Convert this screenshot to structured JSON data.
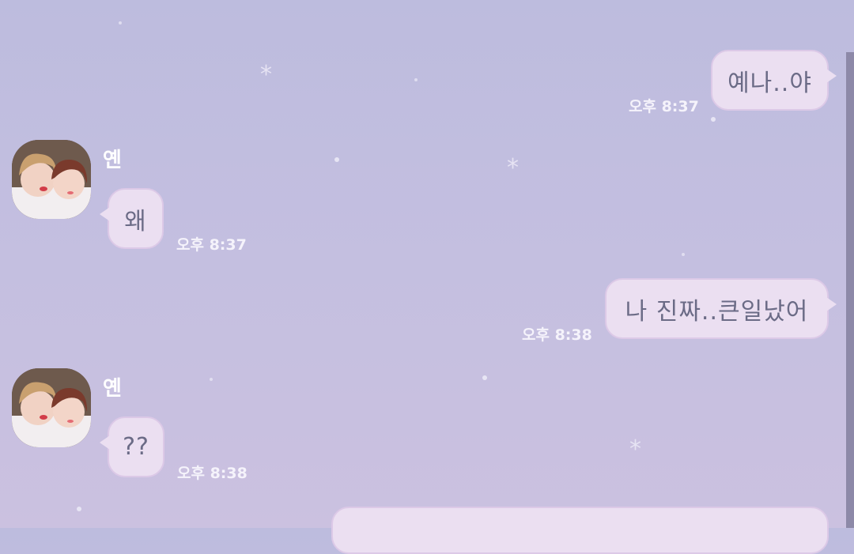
{
  "chat": {
    "messages": [
      {
        "side": "out",
        "text": "예나..야",
        "time": "오후 8:37"
      },
      {
        "side": "in",
        "sender": "옌",
        "text": "왜",
        "time": "오후 8:37"
      },
      {
        "side": "out",
        "text": "나 진짜..큰일났어",
        "time": "오후 8:38"
      },
      {
        "side": "in",
        "sender": "옌",
        "text": "??",
        "time": "오후 8:38"
      }
    ]
  },
  "colors": {
    "background_top": "#bdbcde",
    "bubble": "#ebdff1",
    "bubble_text": "#6b6b86",
    "timestamp": "#f5f3fb"
  },
  "icons": [
    "sparkle-icon"
  ]
}
